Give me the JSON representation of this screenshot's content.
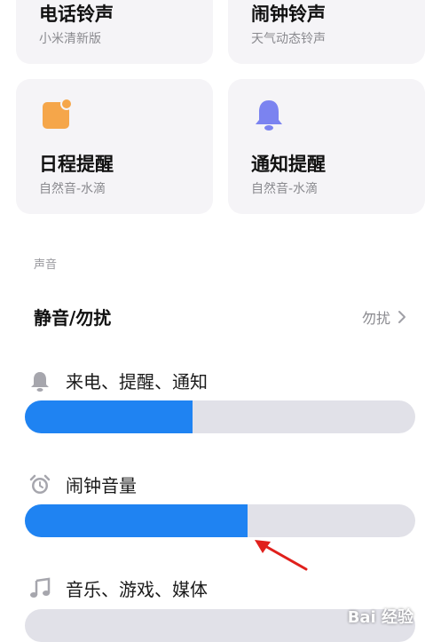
{
  "ringtone_cards": [
    {
      "title": "电话铃声",
      "subtitle": "小米清新版"
    },
    {
      "title": "闹钟铃声",
      "subtitle": "天气动态铃声"
    },
    {
      "title": "日程提醒",
      "subtitle": "自然音-水滴",
      "icon": "calendar-icon",
      "icon_color": "#f5a64a"
    },
    {
      "title": "通知提醒",
      "subtitle": "自然音-水滴",
      "icon": "bell-icon",
      "icon_color": "#7b83f0"
    }
  ],
  "sound_section": {
    "label": "声音",
    "silent_row": {
      "title": "静音/勿扰",
      "value": "勿扰"
    }
  },
  "volume_sliders": [
    {
      "label": "来电、提醒、通知",
      "icon": "bell-icon",
      "level": 0.43
    },
    {
      "label": "闹钟音量",
      "icon": "alarm-clock-icon",
      "level": 0.57
    },
    {
      "label": "音乐、游戏、媒体",
      "icon": "music-note-icon",
      "level": 0.0
    }
  ],
  "colors": {
    "accent": "#1f83f2",
    "track": "#e1e1e8",
    "card_bg": "#f5f4f7",
    "arrow": "#e0201c"
  },
  "watermark": "Bai 经验"
}
